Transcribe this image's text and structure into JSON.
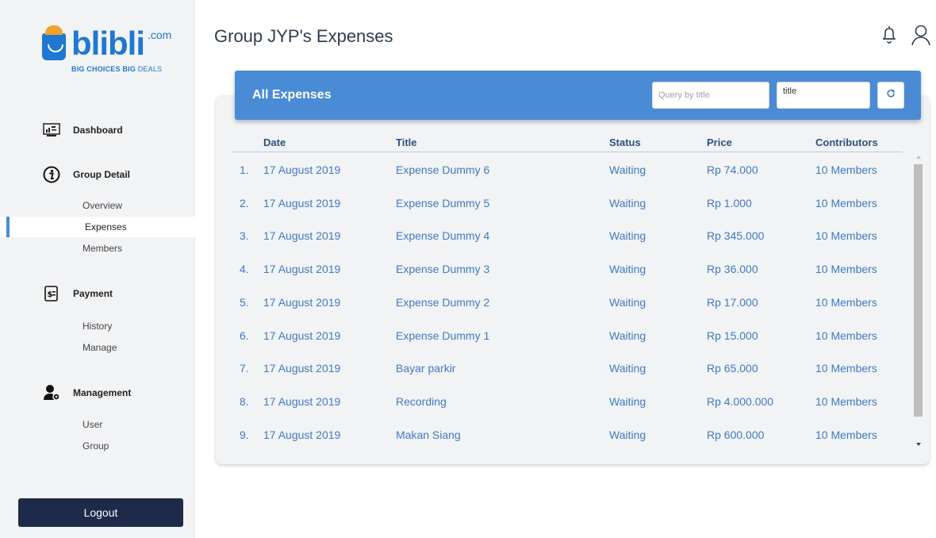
{
  "brand": {
    "name": "blibli",
    "domain": ".com",
    "tagline_bold1": "BIG CHOICES",
    "tagline_bold2": "BIG",
    "tagline_thin": "DEALS"
  },
  "sidebar": {
    "dashboard": "Dashboard",
    "group_detail": "Group Detail",
    "group_items": [
      "Overview",
      "Expenses",
      "Members"
    ],
    "payment": "Payment",
    "payment_items": [
      "History",
      "Manage"
    ],
    "management": "Management",
    "management_items": [
      "User",
      "Group"
    ],
    "logout": "Logout"
  },
  "page": {
    "title": "Group JYP's Expenses"
  },
  "card": {
    "title": "All Expenses",
    "search_placeholder": "Query by title",
    "field_value": "title"
  },
  "table": {
    "headers": {
      "date": "Date",
      "title": "Title",
      "status": "Status",
      "price": "Price",
      "contributors": "Contributors"
    },
    "rows": [
      {
        "index": "1.",
        "date": "17 August 2019",
        "title": "Expense Dummy 6",
        "status": "Waiting",
        "price": "Rp 74.000",
        "contributors": "10 Members"
      },
      {
        "index": "2.",
        "date": "17 August 2019",
        "title": "Expense Dummy 5",
        "status": "Waiting",
        "price": "Rp 1.000",
        "contributors": "10 Members"
      },
      {
        "index": "3.",
        "date": "17 August 2019",
        "title": "Expense Dummy 4",
        "status": "Waiting",
        "price": "Rp 345.000",
        "contributors": "10 Members"
      },
      {
        "index": "4.",
        "date": "17 August 2019",
        "title": "Expense Dummy 3",
        "status": "Waiting",
        "price": "Rp 36.000",
        "contributors": "10 Members"
      },
      {
        "index": "5.",
        "date": "17 August 2019",
        "title": "Expense Dummy 2",
        "status": "Waiting",
        "price": "Rp 17.000",
        "contributors": "10 Members"
      },
      {
        "index": "6.",
        "date": "17 August 2019",
        "title": "Expense Dummy 1",
        "status": "Waiting",
        "price": "Rp 15.000",
        "contributors": "10 Members"
      },
      {
        "index": "7.",
        "date": "17 August 2019",
        "title": "Bayar parkir",
        "status": "Waiting",
        "price": "Rp 65.000",
        "contributors": "10 Members"
      },
      {
        "index": "8.",
        "date": "17 August 2019",
        "title": "Recording",
        "status": "Waiting",
        "price": "Rp 4.000.000",
        "contributors": "10 Members"
      },
      {
        "index": "9.",
        "date": "17 August 2019",
        "title": "Makan Siang",
        "status": "Waiting",
        "price": "Rp 600.000",
        "contributors": "10 Members"
      }
    ]
  },
  "colors": {
    "accent": "#4a8bd6",
    "navy": "#1e2a4a",
    "link": "#3f7ac4",
    "header_text": "#2d4f82"
  },
  "icons": [
    "dashboard-icon",
    "info-icon",
    "payment-icon",
    "management-icon",
    "bell-icon",
    "user-icon",
    "refresh-icon"
  ]
}
